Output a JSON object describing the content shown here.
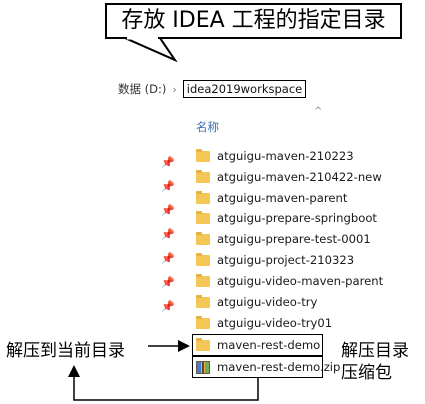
{
  "callout_top": "存放 IDEA 工程的指定目录",
  "breadcrumb": {
    "drive": "数据 (D:)",
    "separator": "›",
    "current": "idea2019workspace"
  },
  "list": {
    "column_header": "名称",
    "sort_indicator": "^",
    "pin_icon": "pin-icon",
    "items": [
      {
        "name": "atguigu-maven-210223",
        "type": "folder"
      },
      {
        "name": "atguigu-maven-210422-new",
        "type": "folder"
      },
      {
        "name": "atguigu-maven-parent",
        "type": "folder"
      },
      {
        "name": "atguigu-prepare-springboot",
        "type": "folder"
      },
      {
        "name": "atguigu-prepare-test-0001",
        "type": "folder"
      },
      {
        "name": "atguigu-project-210323",
        "type": "folder"
      },
      {
        "name": "atguigu-video-maven-parent",
        "type": "folder"
      },
      {
        "name": "atguigu-video-try",
        "type": "folder"
      },
      {
        "name": "atguigu-video-try01",
        "type": "folder"
      },
      {
        "name": "maven-rest-demo",
        "type": "folder"
      },
      {
        "name": "maven-rest-demo.zip",
        "type": "zip"
      }
    ]
  },
  "annotations": {
    "extract_here": "解压到当前目录",
    "extracted_dir": "解压目录",
    "zip_label": "压缩包"
  },
  "colors": {
    "folder": "#f4c655",
    "header_text": "#3a6ea8"
  }
}
